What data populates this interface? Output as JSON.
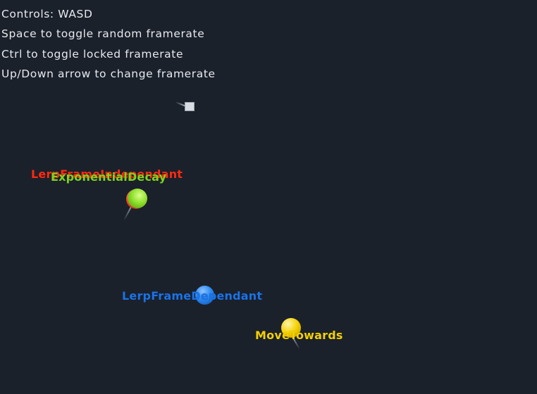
{
  "hud": {
    "controls": "Controls: WASD",
    "random_framerate": "Space to toggle random framerate",
    "locked_framerate": "Ctrl to toggle locked framerate",
    "change_framerate": "Up/Down arrow to change framerate"
  },
  "objects": {
    "lerp_frame_independant": {
      "label": "LerpFrameIndependant",
      "color": "#ff2a12"
    },
    "exponential_decay": {
      "label": "ExponentialDecay",
      "color": "#7ed321"
    },
    "lerp_frame_dependant": {
      "label": "LerpFrameDependant",
      "color": "#1a73e8"
    },
    "move_towards": {
      "label": "MoveTowards",
      "color": "#f5d000"
    }
  },
  "background_color": "#1b212b"
}
